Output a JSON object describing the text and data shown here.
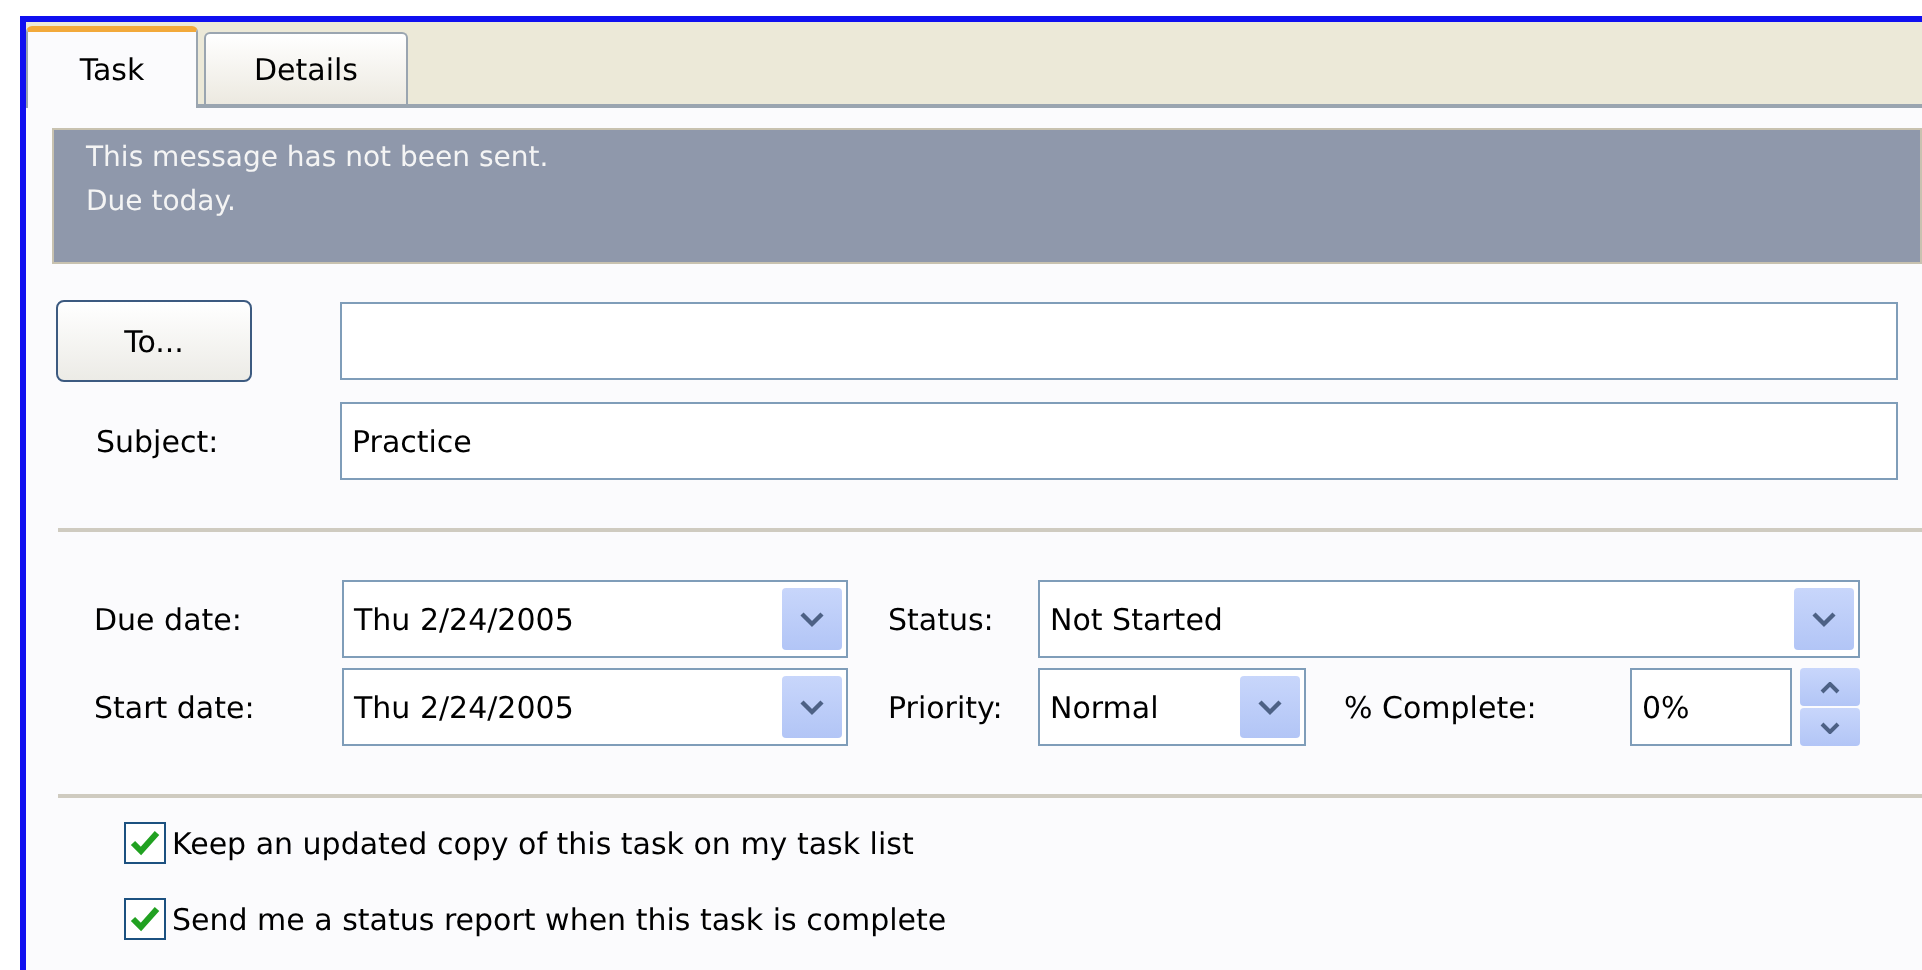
{
  "tabs": [
    {
      "label": "Task",
      "selected": true
    },
    {
      "label": "Details",
      "selected": false
    }
  ],
  "info_bar": {
    "lines": [
      "This message has not been sent.",
      "Due today."
    ]
  },
  "to": {
    "button": "To..."
  },
  "subject": {
    "label": "Subject:",
    "value": "Practice"
  },
  "due_date": {
    "label": "Due date:",
    "value": "Thu 2/24/2005"
  },
  "start_date": {
    "label": "Start date:",
    "value": "Thu 2/24/2005"
  },
  "status": {
    "label": "Status:",
    "value": "Not Started"
  },
  "priority": {
    "label": "Priority:",
    "value": "Normal"
  },
  "complete": {
    "label": "% Complete:",
    "value": "0%"
  },
  "options": [
    {
      "label": "Keep an updated copy of this task on my task list",
      "checked": true
    },
    {
      "label": "Send me a status report when this task is complete",
      "checked": true
    }
  ]
}
